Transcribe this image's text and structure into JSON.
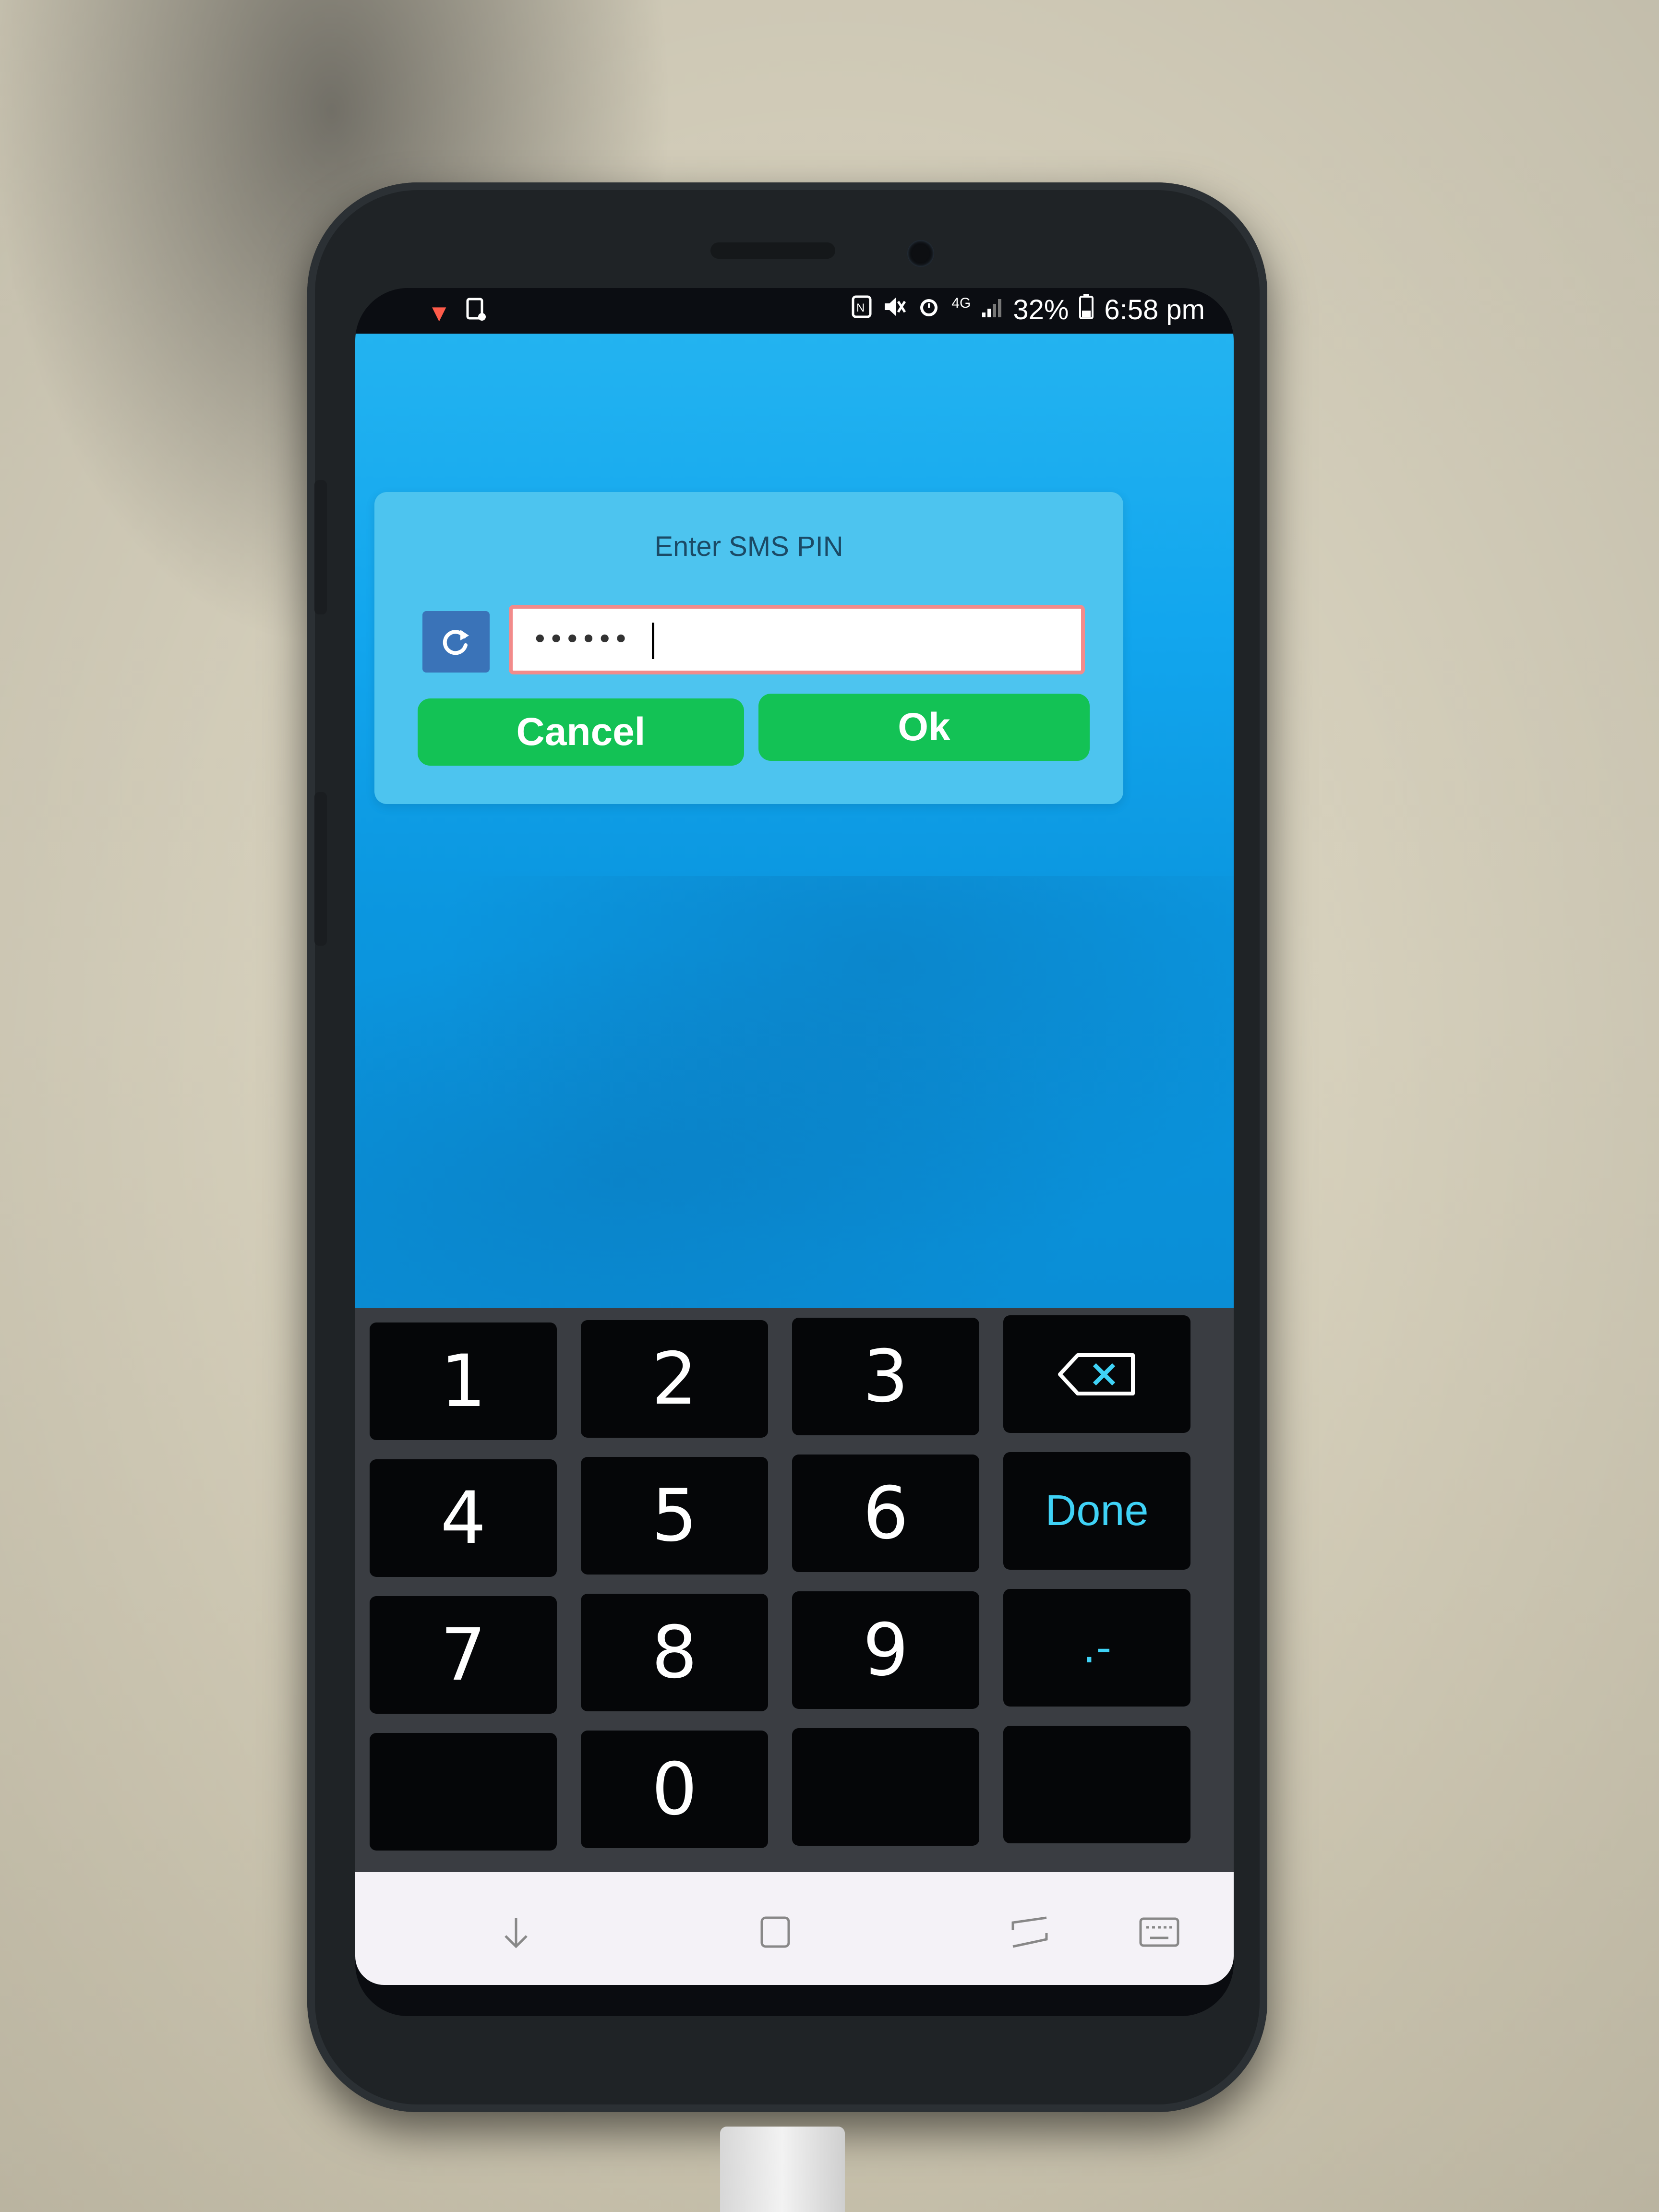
{
  "status_bar": {
    "network": "4G",
    "battery": "32%",
    "time": "6:58 pm",
    "icons": [
      "notification-icon",
      "sim-icon",
      "nfc-icon",
      "mute-icon",
      "alarm-icon",
      "signal-icon",
      "battery-icon"
    ]
  },
  "dialog": {
    "title": "Enter SMS PIN",
    "pin_value": "••••••",
    "refresh_icon": "refresh-icon",
    "cancel_label": "Cancel",
    "ok_label": "Ok"
  },
  "keypad": {
    "keys": [
      "1",
      "2",
      "3",
      "4",
      "5",
      "6",
      "7",
      "8",
      "9",
      "0"
    ],
    "done_label": "Done",
    "symbol_label": ".-",
    "backspace_icon": "backspace-icon"
  },
  "nav_bar": {
    "icons": [
      "hide-keyboard-icon",
      "home-icon",
      "recents-icon",
      "keyboard-icon"
    ]
  },
  "colors": {
    "app_background": "#12a6ee",
    "dialog_background": "#4dc4ef",
    "button_green": "#13c255",
    "input_border": "#f28b8b",
    "accent_cyan": "#3fd2f6",
    "key_background": "#050608"
  }
}
